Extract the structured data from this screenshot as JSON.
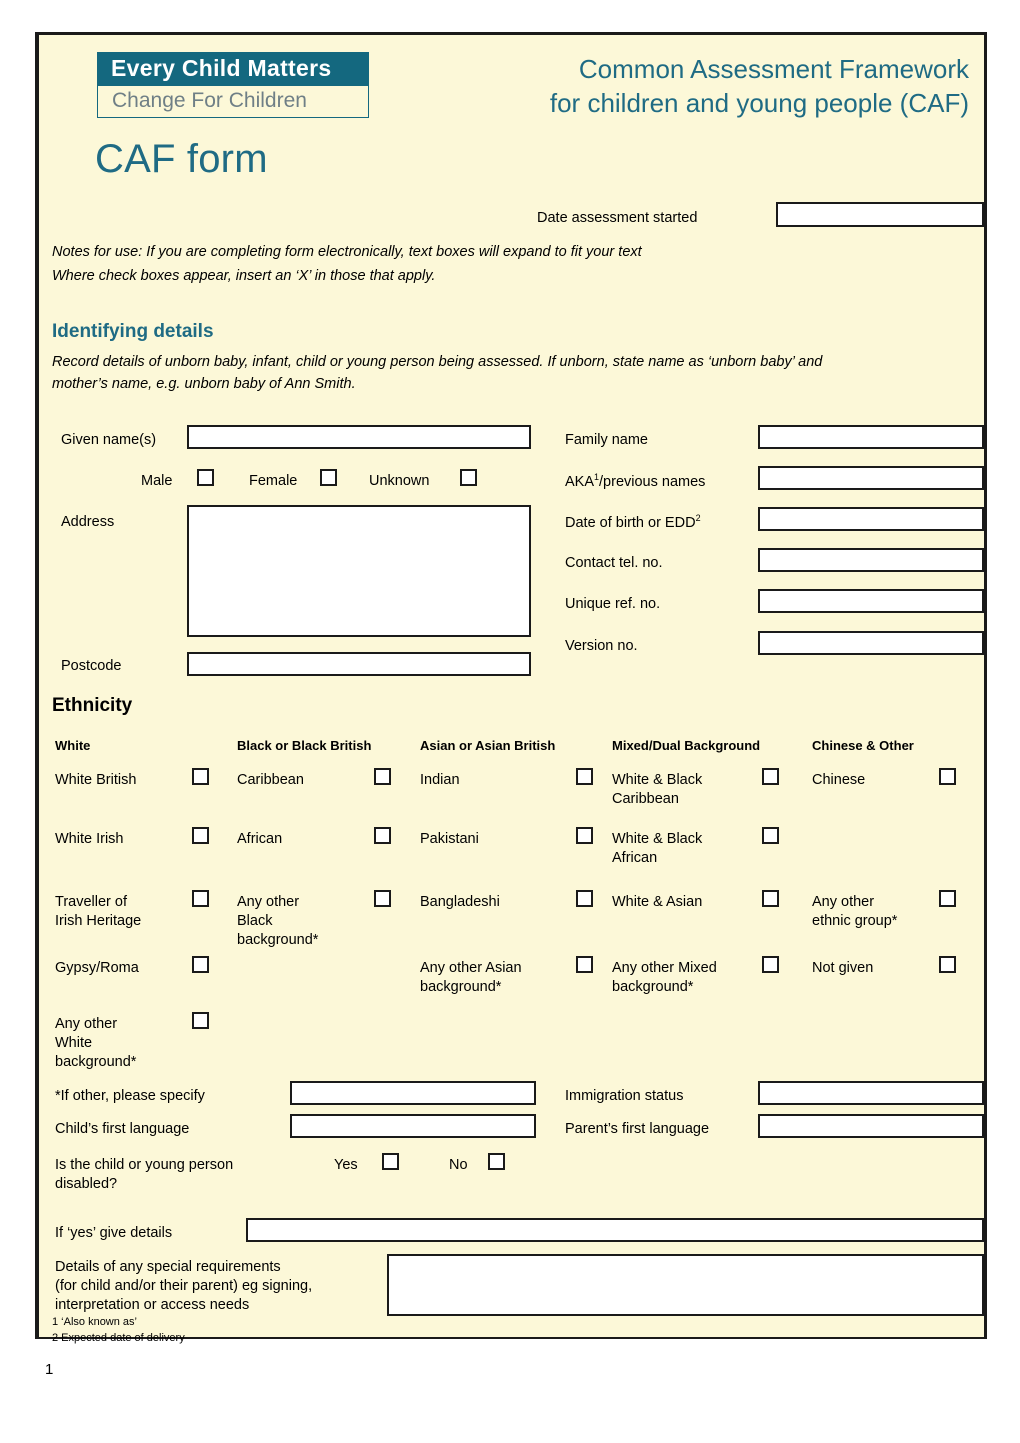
{
  "brand": {
    "logo_line1": "Every Child Matters",
    "logo_line2": "Change For Children",
    "title_line1": "Common Assessment Framework",
    "title_line2": "for children and young people (CAF)",
    "form_title": "CAF form",
    "teal": "#1f6b84",
    "panel_bg": "#fcf8d8"
  },
  "header": {
    "date_label": "Date assessment started",
    "date_value": "",
    "notes_line1": "Notes for use: If you are completing form electronically, text boxes will expand to fit your text",
    "notes_line2": "Where check boxes appear, insert an ‘X’ in those that apply."
  },
  "identifying": {
    "heading": "Identifying details",
    "intro_line1": "Record details of unborn baby, infant, child or young person being assessed. If unborn, state name as ‘unborn baby’ and",
    "intro_line2": "mother’s name, e.g. unborn baby of Ann Smith.",
    "given_names_label": "Given name(s)",
    "given_names_value": "",
    "sex_options": [
      {
        "label": "Male",
        "checked": false
      },
      {
        "label": "Female",
        "checked": false
      },
      {
        "label": "Unknown",
        "checked": false
      }
    ],
    "address_label": "Address",
    "address_value": "",
    "postcode_label": "Postcode",
    "postcode_value": "",
    "family_name_label": "Family name",
    "family_name_value": "",
    "aka_label": "AKA",
    "aka_sup": "1",
    "aka_label_rest": "/previous names",
    "aka_value": "",
    "dob_label": "Date of birth or EDD",
    "dob_sup": "2",
    "dob_value": "",
    "tel_label": "Contact tel. no.",
    "tel_value": "",
    "uniqueref_label": "Unique ref. no.",
    "uniqueref_value": "",
    "version_label": "Version no.",
    "version_value": ""
  },
  "ethnicity": {
    "heading": "Ethnicity",
    "columns": [
      {
        "header": "White",
        "items": [
          {
            "label": "White British",
            "checked": false
          },
          {
            "label": "White Irish",
            "checked": false
          },
          {
            "label": "Traveller of\nIrish Heritage",
            "checked": false
          },
          {
            "label": "Gypsy/Roma",
            "checked": false
          },
          {
            "label": "Any other\nWhite\nbackground*",
            "checked": false
          }
        ]
      },
      {
        "header": "Black or Black British",
        "items": [
          {
            "label": "Caribbean",
            "checked": false
          },
          {
            "label": "African",
            "checked": false
          },
          {
            "label": "Any other\nBlack\nbackground*",
            "checked": false
          }
        ]
      },
      {
        "header": "Asian or Asian British",
        "items": [
          {
            "label": "Indian",
            "checked": false
          },
          {
            "label": "Pakistani",
            "checked": false
          },
          {
            "label": "Bangladeshi",
            "checked": false
          },
          {
            "label": "Any other Asian\nbackground*",
            "checked": false
          }
        ]
      },
      {
        "header": "Mixed/Dual Background",
        "items": [
          {
            "label": "White & Black\nCaribbean",
            "checked": false
          },
          {
            "label": "White & Black\nAfrican",
            "checked": false
          },
          {
            "label": "White & Asian",
            "checked": false
          },
          {
            "label": "Any other Mixed\nbackground*",
            "checked": false
          }
        ]
      },
      {
        "header": "Chinese & Other",
        "items": [
          {
            "label": "Chinese",
            "checked": false
          },
          {
            "label": "Any other\nethnic group*",
            "checked": false
          },
          {
            "label": "Not given",
            "checked": false
          }
        ]
      }
    ]
  },
  "details": {
    "if_other_label": "*If other, please specify",
    "if_other_value": "",
    "immigration_label": "Immigration status",
    "immigration_value": "",
    "child_language_label": "Child’s first language",
    "child_language_value": "",
    "parent_language_label": "Parent’s first language",
    "parent_language_value": "",
    "disabled_question": "Is the child or young person\ndisabled?",
    "disabled_yes": "Yes",
    "disabled_no": "No",
    "if_yes_label": "If ‘yes’ give details",
    "if_yes_value": "",
    "special_req_label": "Details of any special requirements\n(for child and/or their parent) eg signing,\ninterpretation or access needs",
    "special_req_value": ""
  },
  "footnotes": {
    "note1": "1 ‘Also known as’",
    "note2": "2 Expected date of delivery"
  },
  "footer": {
    "page_number": "1"
  }
}
